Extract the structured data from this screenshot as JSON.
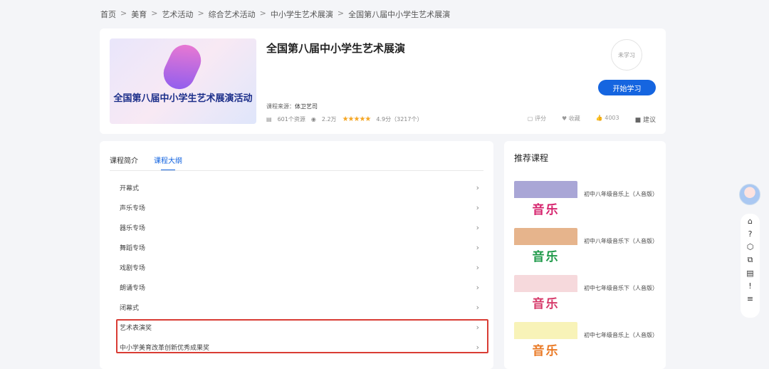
{
  "breadcrumb": [
    "首页",
    "美育",
    "艺术活动",
    "综合艺术活动",
    "中小学生艺术展演",
    "全国第八届中小学生艺术展演"
  ],
  "course": {
    "cover_text": "全国第八届中小学生艺术展演活动",
    "title": "全国第八届中小学生艺术展演",
    "status": "未学习",
    "start_label": "开始学习",
    "source_label": "课程来源：",
    "source": "体卫艺司",
    "resources": "601个资源",
    "views": "2.2万",
    "rating_text": "4.9分（3217个）",
    "rating": 4.9,
    "actions": {
      "rate": "评分",
      "favorite": "收藏",
      "likes": "4003",
      "suggest": "建议"
    }
  },
  "tabs": [
    "课程简介",
    "课程大纲"
  ],
  "outline": [
    "开幕式",
    "声乐专场",
    "器乐专场",
    "舞蹈专场",
    "戏剧专场",
    "朗诵专场",
    "闭幕式",
    "艺术表演奖",
    "中小学美育改革创新优秀成果奖"
  ],
  "recommend": {
    "title": "推荐课程",
    "thumb_text": "音乐",
    "items": [
      {
        "label": "初中八年级音乐上（人音版）",
        "band": "#a9a6d6",
        "color": "#d6246e"
      },
      {
        "label": "初中八年级音乐下（人音版）",
        "band": "#e6b48c",
        "color": "#1f9a4a"
      },
      {
        "label": "初中七年级音乐下（人音版）",
        "band": "#f6d9dc",
        "color": "#d63a6a"
      },
      {
        "label": "初中七年级音乐上（人音版）",
        "band": "#f8f3b8",
        "color": "#ea7a26"
      }
    ]
  },
  "toolbar": [
    "⌂",
    "?",
    "⬡",
    "⧉",
    "▤",
    "!",
    "≡"
  ]
}
